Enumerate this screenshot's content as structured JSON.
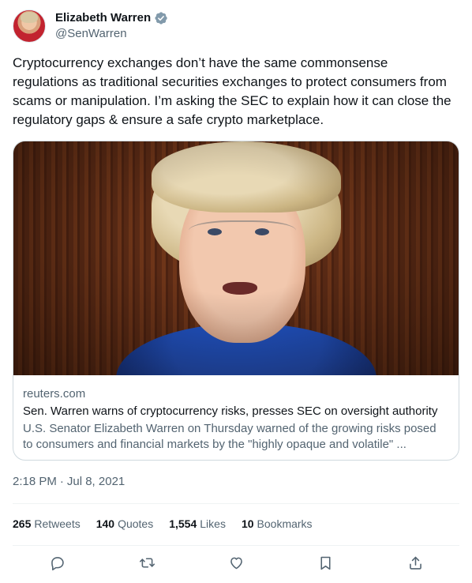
{
  "author": {
    "display_name": "Elizabeth Warren",
    "handle": "@SenWarren"
  },
  "tweet": {
    "text": "Cryptocurrency exchanges don’t have the same commonsense regulations as traditional securities exchanges to protect consumers from scams or manipulation. I’m asking the SEC to explain how it can close the regulatory gaps & ensure a safe crypto marketplace."
  },
  "card": {
    "domain": "reuters.com",
    "title": "Sen. Warren warns of cryptocurrency risks, presses SEC on oversight authority",
    "description": "U.S. Senator Elizabeth Warren on Thursday warned of the growing risks posed to consumers and financial markets by the \"highly opaque and volatile\" ..."
  },
  "meta": {
    "time": "2:18 PM",
    "separator": "·",
    "date": "Jul 8, 2021"
  },
  "stats": {
    "retweets": {
      "count": "265",
      "label": "Retweets"
    },
    "quotes": {
      "count": "140",
      "label": "Quotes"
    },
    "likes": {
      "count": "1,554",
      "label": "Likes"
    },
    "bookmarks": {
      "count": "10",
      "label": "Bookmarks"
    }
  },
  "icons": {
    "verified": "verified-badge-icon",
    "reply": "reply-icon",
    "retweet": "retweet-icon",
    "like": "heart-icon",
    "bookmark": "bookmark-icon",
    "share": "share-icon"
  },
  "colors": {
    "text_primary": "#0f1419",
    "text_secondary": "#536471",
    "verified_badge": "#829aab",
    "border": "#cfd9de"
  }
}
